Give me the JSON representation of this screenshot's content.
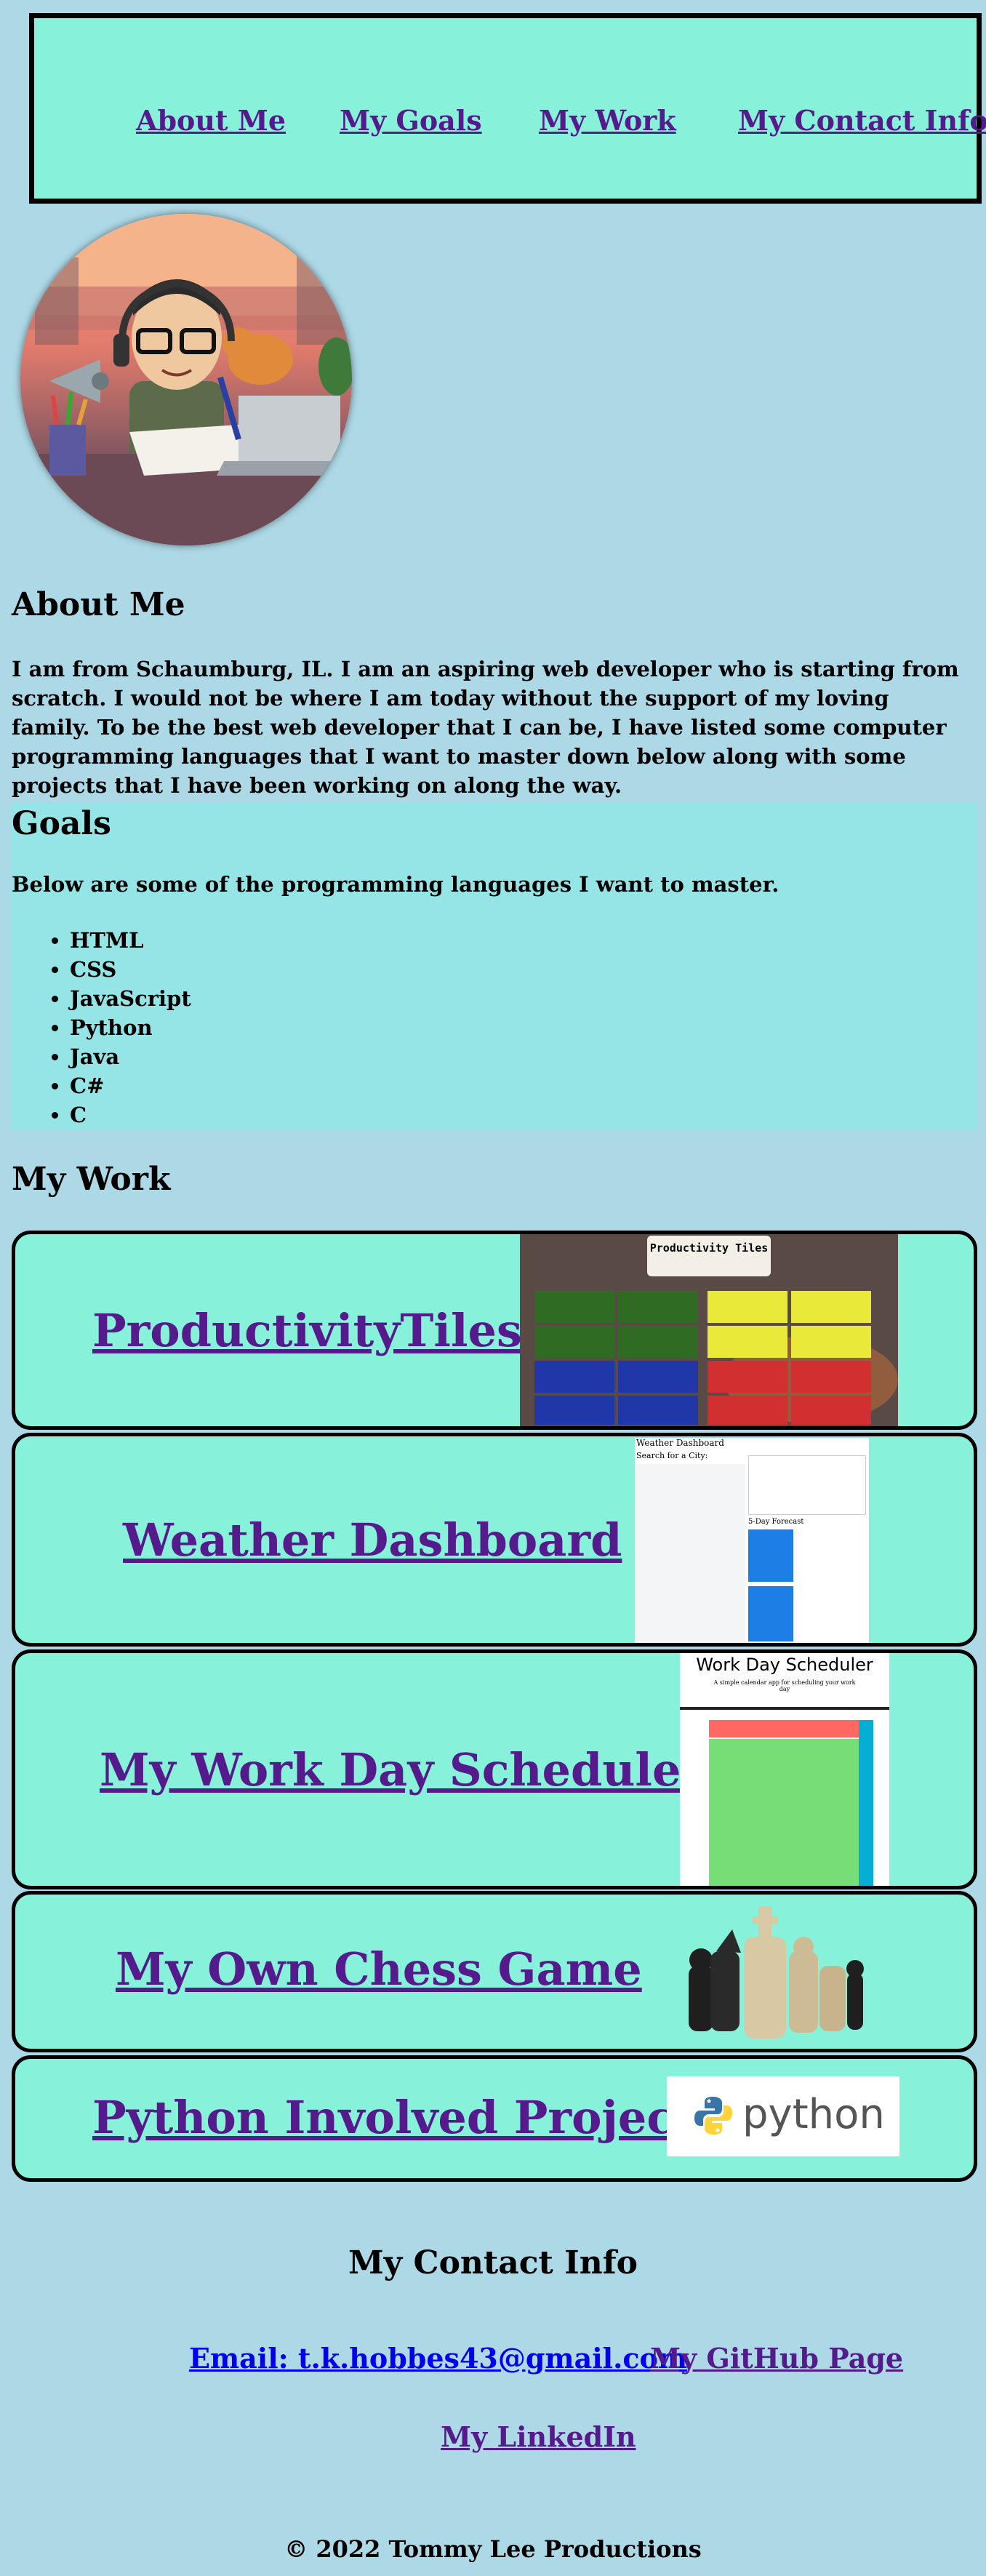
{
  "nav": {
    "about": "About Me",
    "goals": "My Goals",
    "work": "My Work",
    "contact": "My Contact Info"
  },
  "about": {
    "heading": "About Me",
    "text": "I am from Schaumburg, IL. I am an aspiring web developer who is starting from scratch. I would not be where I am today without the support of my loving family. To be the best web developer that I can be, I have listed some computer programming languages that I want to master down below along with some projects that I have been working on along the way."
  },
  "goals": {
    "heading": "Goals",
    "intro": "Below are some of the programming languages I want to master.",
    "languages": [
      "HTML",
      "CSS",
      "JavaScript",
      "Python",
      "Java",
      "C#",
      "C"
    ]
  },
  "work": {
    "heading": "My Work",
    "projects": [
      {
        "title": "ProductivityTiles",
        "thumb_caption": "Productivity Tiles"
      },
      {
        "title": "Weather Dashboard",
        "thumb_caption": "Weather Dashboard",
        "thumb_search": "Search for a City:",
        "thumb_forecast": "5-Day Forecast"
      },
      {
        "title": "My Work Day Scheduler",
        "thumb_caption": "Work Day Scheduler",
        "thumb_sub": "A simple calendar app for scheduling your work day"
      },
      {
        "title": "My Own Chess Game"
      },
      {
        "title": "Python Involved Project",
        "thumb_caption": "python"
      }
    ]
  },
  "contact": {
    "heading": "My Contact Info",
    "email": "Email: t.k.hobbes43@gmail.com",
    "github": "My GitHub Page",
    "linkedin": "My LinkedIn"
  },
  "footer": "© 2022 Tommy Lee Productions",
  "colors": {
    "page_bg": "#add8e6",
    "nav_bg": "#87f1d9",
    "goals_bg": "#96e5e6",
    "card_bg": "#87f1d9",
    "link_visited": "#551a8b",
    "link": "#0000ee"
  }
}
